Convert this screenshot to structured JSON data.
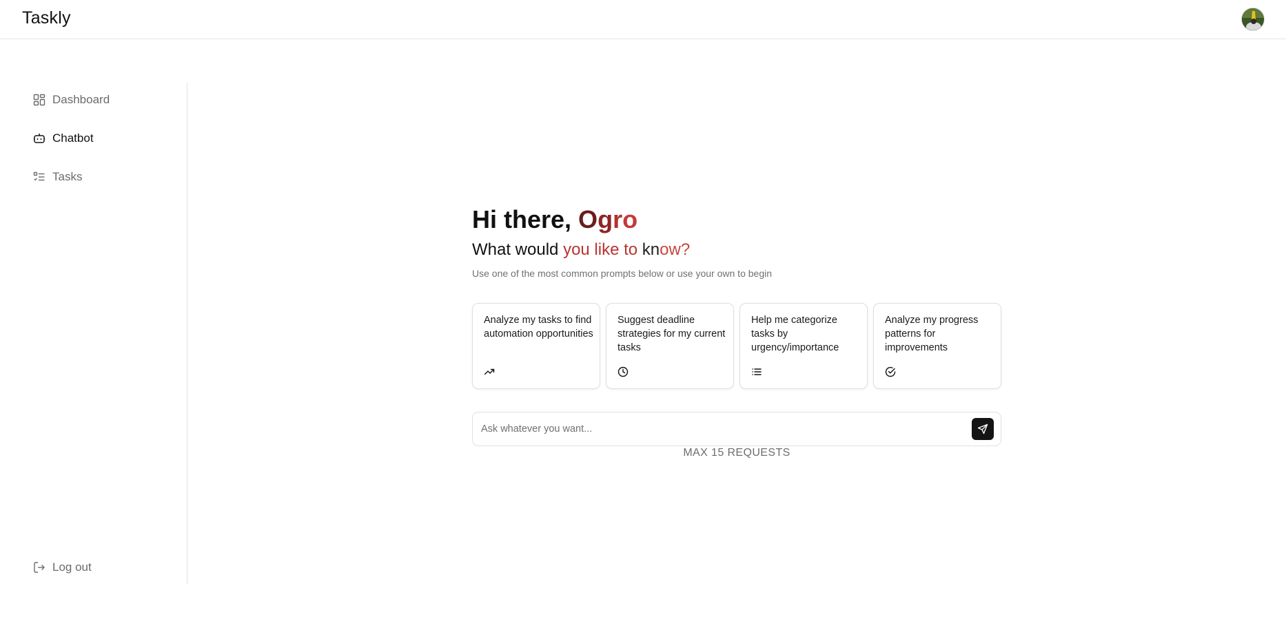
{
  "app": {
    "brand": "Taskly",
    "accent_color": "#b73431"
  },
  "sidebar": {
    "items": [
      {
        "label": "Dashboard",
        "icon": "dashboard-icon",
        "active": false
      },
      {
        "label": "Chatbot",
        "icon": "bot-icon",
        "active": true
      },
      {
        "label": "Tasks",
        "icon": "tasks-list-icon",
        "active": false
      }
    ],
    "logout_label": "Log out",
    "logout_icon": "logout-icon"
  },
  "main": {
    "greeting_prefix": "Hi there, ",
    "greeting_name_letters": [
      "O",
      "g",
      "r",
      "o"
    ],
    "subtitle_part1": "What would ",
    "subtitle_part2": "you like to",
    "subtitle_part3": " kn",
    "subtitle_part4": "ow?",
    "hint": "Use one of the most common prompts below or use your own to begin",
    "prompt_cards": [
      {
        "text": "Analyze my tasks to find automation opportunities",
        "icon": "trending-up-icon"
      },
      {
        "text": "Suggest deadline strategies for my current tasks",
        "icon": "clock-icon"
      },
      {
        "text": "Help me categorize tasks by urgency/importance",
        "icon": "list-icon"
      },
      {
        "text": "Analyze my progress patterns for improvements",
        "icon": "check-circle-icon"
      }
    ],
    "chat": {
      "placeholder": "Ask whatever you want...",
      "value": "",
      "send_icon": "send-icon"
    },
    "limit_text": "MAX 15 REQUESTS"
  }
}
